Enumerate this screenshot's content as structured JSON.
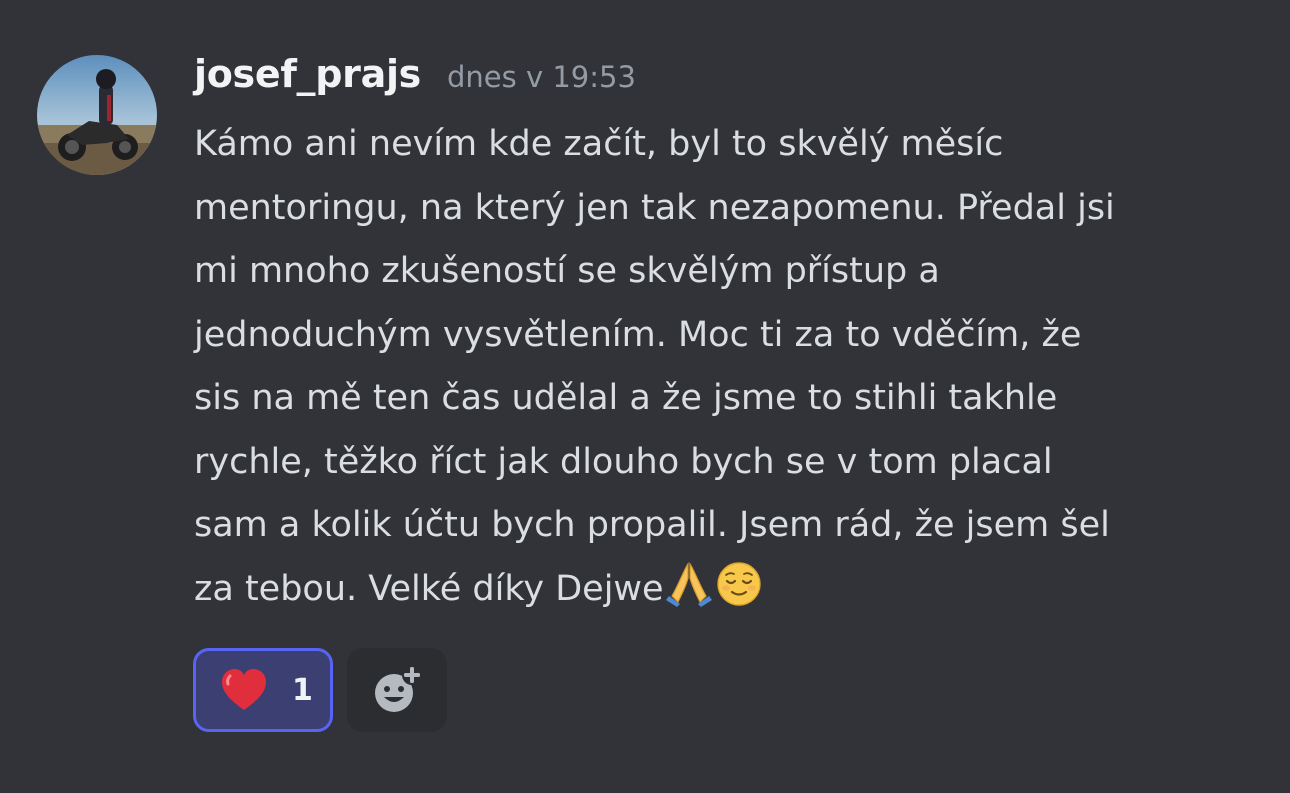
{
  "message": {
    "author": "josef_prajs",
    "timestamp": "dnes v 19:53",
    "lines": [
      "Kámo ani nevím kde začít, byl to skvělý měsíc",
      "mentoringu, na který jen tak nezapomenu. Předal jsi",
      "mi mnoho zkušeností se skvělým přístup a",
      "jednoduchým vysvětlením. Moc ti za to vděčím, že",
      "sis na mě ten čas udělal a že jsme to stihli takhle",
      "rychle, těžko říct jak dlouho bych se v tom placal",
      "sam a kolik účtu bych propalil. Jsem rád, že jsem šel",
      "za tebou. Velké díky Dejwe"
    ],
    "emojis": [
      "folded-hands-emoji",
      "relieved-face-emoji"
    ]
  },
  "reactions": [
    {
      "emoji": "heart-emoji",
      "count": "1"
    }
  ],
  "add_reaction_icon": "add-reaction-icon",
  "colors": {
    "background": "#313338",
    "accent": "#5865f2",
    "reaction_bg": "#3b3f72",
    "username": "#f2f3f5",
    "timestamp": "#949ba4",
    "text": "#dbdee1"
  }
}
